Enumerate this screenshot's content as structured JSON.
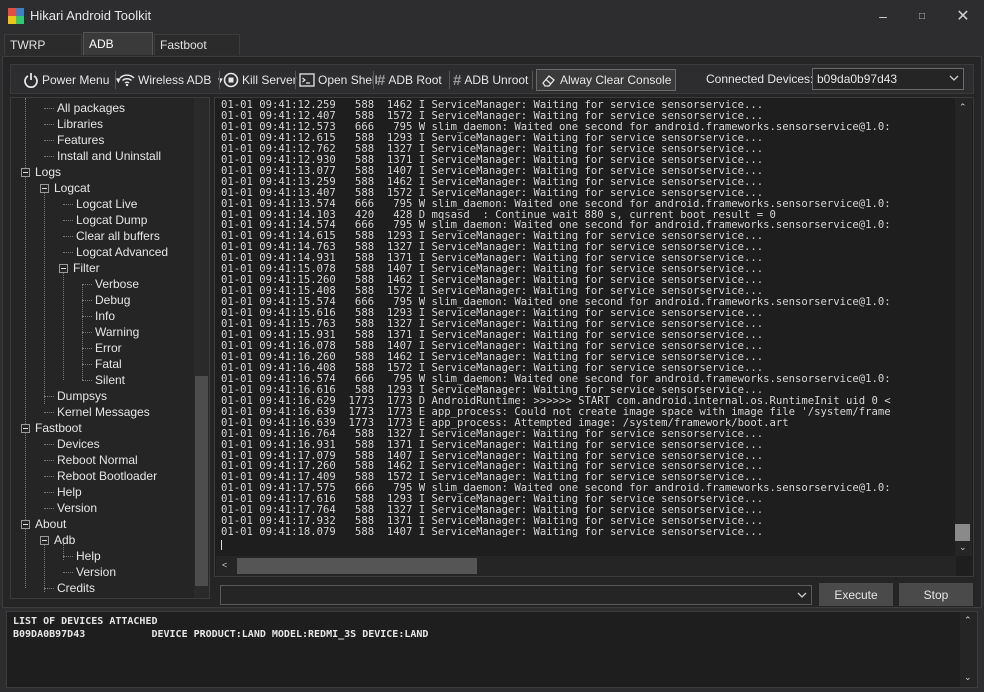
{
  "window": {
    "title": "Hikari Android Toolkit"
  },
  "tabs": [
    "TWRP Toolkit",
    "ADB Toolkit",
    "Fastboot Toolkit"
  ],
  "active_tab": "ADB Toolkit",
  "toolbar": {
    "power_menu": "Power Menu",
    "wireless_adb": "Wireless ADB",
    "kill_server": "Kill Server",
    "open_shell": "Open Shell",
    "adb_root": "ADB Root",
    "adb_unroot": "ADB Unroot",
    "clear_console": "Alway Clear Console",
    "devices_label": "Connected Devices:",
    "device_selected": "b09da0b97d43"
  },
  "tree": [
    {
      "label": "All packages",
      "level": 2
    },
    {
      "label": "Libraries",
      "level": 2
    },
    {
      "label": "Features",
      "level": 2
    },
    {
      "label": "Install and Uninstall",
      "level": 2
    },
    {
      "label": "Logs",
      "level": 0,
      "expander": true
    },
    {
      "label": "Logcat",
      "level": 1,
      "expander": true
    },
    {
      "label": "Logcat Live",
      "level": 3
    },
    {
      "label": "Logcat Dump",
      "level": 3
    },
    {
      "label": "Clear all buffers",
      "level": 3
    },
    {
      "label": "Logcat Advanced",
      "level": 3
    },
    {
      "label": "Filter",
      "level": 2,
      "expander": true
    },
    {
      "label": "Verbose",
      "level": 4
    },
    {
      "label": "Debug",
      "level": 4
    },
    {
      "label": "Info",
      "level": 4
    },
    {
      "label": "Warning",
      "level": 4
    },
    {
      "label": "Error",
      "level": 4
    },
    {
      "label": "Fatal",
      "level": 4
    },
    {
      "label": "Silent",
      "level": 4
    },
    {
      "label": "Dumpsys",
      "level": 2
    },
    {
      "label": "Kernel Messages",
      "level": 2
    },
    {
      "label": "Fastboot",
      "level": 0,
      "expander": true
    },
    {
      "label": "Devices",
      "level": 2
    },
    {
      "label": "Reboot Normal",
      "level": 2
    },
    {
      "label": "Reboot Bootloader",
      "level": 2
    },
    {
      "label": "Help",
      "level": 2
    },
    {
      "label": "Version",
      "level": 2
    },
    {
      "label": "About",
      "level": 0,
      "expander": true
    },
    {
      "label": "Adb",
      "level": 1,
      "expander": true
    },
    {
      "label": "Help",
      "level": 3
    },
    {
      "label": "Version",
      "level": 3
    },
    {
      "label": "Credits",
      "level": 2
    }
  ],
  "console_lines": [
    "01-01 09:41:12.259   588  1462 I ServiceManager: Waiting for service sensorservice...",
    "01-01 09:41:12.407   588  1572 I ServiceManager: Waiting for service sensorservice...",
    "01-01 09:41:12.573   666   795 W slim_daemon: Waited one second for android.frameworks.sensorservice@1.0:",
    "01-01 09:41:12.615   588  1293 I ServiceManager: Waiting for service sensorservice...",
    "01-01 09:41:12.762   588  1327 I ServiceManager: Waiting for service sensorservice...",
    "01-01 09:41:12.930   588  1371 I ServiceManager: Waiting for service sensorservice...",
    "01-01 09:41:13.077   588  1407 I ServiceManager: Waiting for service sensorservice...",
    "01-01 09:41:13.259   588  1462 I ServiceManager: Waiting for service sensorservice...",
    "01-01 09:41:13.407   588  1572 I ServiceManager: Waiting for service sensorservice...",
    "01-01 09:41:13.574   666   795 W slim_daemon: Waited one second for android.frameworks.sensorservice@1.0:",
    "01-01 09:41:14.103   420   428 D mqsasd  : Continue wait 880 s, current boot result = 0",
    "01-01 09:41:14.574   666   795 W slim_daemon: Waited one second for android.frameworks.sensorservice@1.0:",
    "01-01 09:41:14.615   588  1293 I ServiceManager: Waiting for service sensorservice...",
    "01-01 09:41:14.763   588  1327 I ServiceManager: Waiting for service sensorservice...",
    "01-01 09:41:14.931   588  1371 I ServiceManager: Waiting for service sensorservice...",
    "01-01 09:41:15.078   588  1407 I ServiceManager: Waiting for service sensorservice...",
    "01-01 09:41:15.260   588  1462 I ServiceManager: Waiting for service sensorservice...",
    "01-01 09:41:15.408   588  1572 I ServiceManager: Waiting for service sensorservice...",
    "01-01 09:41:15.574   666   795 W slim_daemon: Waited one second for android.frameworks.sensorservice@1.0:",
    "01-01 09:41:15.616   588  1293 I ServiceManager: Waiting for service sensorservice...",
    "01-01 09:41:15.763   588  1327 I ServiceManager: Waiting for service sensorservice...",
    "01-01 09:41:15.931   588  1371 I ServiceManager: Waiting for service sensorservice...",
    "01-01 09:41:16.078   588  1407 I ServiceManager: Waiting for service sensorservice...",
    "01-01 09:41:16.260   588  1462 I ServiceManager: Waiting for service sensorservice...",
    "01-01 09:41:16.408   588  1572 I ServiceManager: Waiting for service sensorservice...",
    "01-01 09:41:16.574   666   795 W slim_daemon: Waited one second for android.frameworks.sensorservice@1.0:",
    "01-01 09:41:16.616   588  1293 I ServiceManager: Waiting for service sensorservice...",
    "01-01 09:41:16.629  1773  1773 D AndroidRuntime: >>>>>> START com.android.internal.os.RuntimeInit uid 0 <",
    "01-01 09:41:16.639  1773  1773 E app_process: Could not create image space with image file '/system/frame",
    "01-01 09:41:16.639  1773  1773 E app_process: Attempted image: /system/framework/boot.art",
    "01-01 09:41:16.764   588  1327 I ServiceManager: Waiting for service sensorservice...",
    "01-01 09:41:16.931   588  1371 I ServiceManager: Waiting for service sensorservice...",
    "01-01 09:41:17.079   588  1407 I ServiceManager: Waiting for service sensorservice...",
    "01-01 09:41:17.260   588  1462 I ServiceManager: Waiting for service sensorservice...",
    "01-01 09:41:17.409   588  1572 I ServiceManager: Waiting for service sensorservice...",
    "01-01 09:41:17.575   666   795 W slim_daemon: Waited one second for android.frameworks.sensorservice@1.0:",
    "01-01 09:41:17.616   588  1293 I ServiceManager: Waiting for service sensorservice...",
    "01-01 09:41:17.764   588  1327 I ServiceManager: Waiting for service sensorservice...",
    "01-01 09:41:17.932   588  1371 I ServiceManager: Waiting for service sensorservice...",
    "01-01 09:41:18.079   588  1407 I ServiceManager: Waiting for service sensorservice..."
  ],
  "command": {
    "value": ""
  },
  "buttons": {
    "execute": "Execute",
    "stop": "Stop"
  },
  "output": {
    "line1": "LIST OF DEVICES ATTACHED",
    "line2": "B09DA0B97D43           DEVICE PRODUCT:LAND MODEL:REDMI_3S DEVICE:LAND"
  },
  "colors": {
    "background": "#2d2d30",
    "panel": "#1e1e1e",
    "text": "#dcdcdc"
  }
}
